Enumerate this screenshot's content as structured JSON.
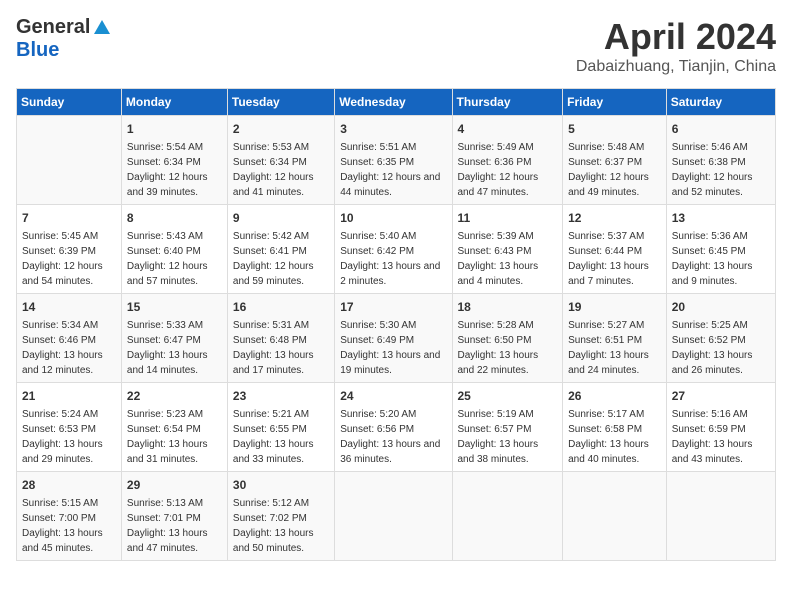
{
  "header": {
    "logo_general": "General",
    "logo_blue": "Blue",
    "title": "April 2024",
    "location": "Dabaizhuang, Tianjin, China"
  },
  "columns": [
    "Sunday",
    "Monday",
    "Tuesday",
    "Wednesday",
    "Thursday",
    "Friday",
    "Saturday"
  ],
  "weeks": [
    [
      {
        "day": "",
        "sunrise": "",
        "sunset": "",
        "daylight": ""
      },
      {
        "day": "1",
        "sunrise": "Sunrise: 5:54 AM",
        "sunset": "Sunset: 6:34 PM",
        "daylight": "Daylight: 12 hours and 39 minutes."
      },
      {
        "day": "2",
        "sunrise": "Sunrise: 5:53 AM",
        "sunset": "Sunset: 6:34 PM",
        "daylight": "Daylight: 12 hours and 41 minutes."
      },
      {
        "day": "3",
        "sunrise": "Sunrise: 5:51 AM",
        "sunset": "Sunset: 6:35 PM",
        "daylight": "Daylight: 12 hours and 44 minutes."
      },
      {
        "day": "4",
        "sunrise": "Sunrise: 5:49 AM",
        "sunset": "Sunset: 6:36 PM",
        "daylight": "Daylight: 12 hours and 47 minutes."
      },
      {
        "day": "5",
        "sunrise": "Sunrise: 5:48 AM",
        "sunset": "Sunset: 6:37 PM",
        "daylight": "Daylight: 12 hours and 49 minutes."
      },
      {
        "day": "6",
        "sunrise": "Sunrise: 5:46 AM",
        "sunset": "Sunset: 6:38 PM",
        "daylight": "Daylight: 12 hours and 52 minutes."
      }
    ],
    [
      {
        "day": "7",
        "sunrise": "Sunrise: 5:45 AM",
        "sunset": "Sunset: 6:39 PM",
        "daylight": "Daylight: 12 hours and 54 minutes."
      },
      {
        "day": "8",
        "sunrise": "Sunrise: 5:43 AM",
        "sunset": "Sunset: 6:40 PM",
        "daylight": "Daylight: 12 hours and 57 minutes."
      },
      {
        "day": "9",
        "sunrise": "Sunrise: 5:42 AM",
        "sunset": "Sunset: 6:41 PM",
        "daylight": "Daylight: 12 hours and 59 minutes."
      },
      {
        "day": "10",
        "sunrise": "Sunrise: 5:40 AM",
        "sunset": "Sunset: 6:42 PM",
        "daylight": "Daylight: 13 hours and 2 minutes."
      },
      {
        "day": "11",
        "sunrise": "Sunrise: 5:39 AM",
        "sunset": "Sunset: 6:43 PM",
        "daylight": "Daylight: 13 hours and 4 minutes."
      },
      {
        "day": "12",
        "sunrise": "Sunrise: 5:37 AM",
        "sunset": "Sunset: 6:44 PM",
        "daylight": "Daylight: 13 hours and 7 minutes."
      },
      {
        "day": "13",
        "sunrise": "Sunrise: 5:36 AM",
        "sunset": "Sunset: 6:45 PM",
        "daylight": "Daylight: 13 hours and 9 minutes."
      }
    ],
    [
      {
        "day": "14",
        "sunrise": "Sunrise: 5:34 AM",
        "sunset": "Sunset: 6:46 PM",
        "daylight": "Daylight: 13 hours and 12 minutes."
      },
      {
        "day": "15",
        "sunrise": "Sunrise: 5:33 AM",
        "sunset": "Sunset: 6:47 PM",
        "daylight": "Daylight: 13 hours and 14 minutes."
      },
      {
        "day": "16",
        "sunrise": "Sunrise: 5:31 AM",
        "sunset": "Sunset: 6:48 PM",
        "daylight": "Daylight: 13 hours and 17 minutes."
      },
      {
        "day": "17",
        "sunrise": "Sunrise: 5:30 AM",
        "sunset": "Sunset: 6:49 PM",
        "daylight": "Daylight: 13 hours and 19 minutes."
      },
      {
        "day": "18",
        "sunrise": "Sunrise: 5:28 AM",
        "sunset": "Sunset: 6:50 PM",
        "daylight": "Daylight: 13 hours and 22 minutes."
      },
      {
        "day": "19",
        "sunrise": "Sunrise: 5:27 AM",
        "sunset": "Sunset: 6:51 PM",
        "daylight": "Daylight: 13 hours and 24 minutes."
      },
      {
        "day": "20",
        "sunrise": "Sunrise: 5:25 AM",
        "sunset": "Sunset: 6:52 PM",
        "daylight": "Daylight: 13 hours and 26 minutes."
      }
    ],
    [
      {
        "day": "21",
        "sunrise": "Sunrise: 5:24 AM",
        "sunset": "Sunset: 6:53 PM",
        "daylight": "Daylight: 13 hours and 29 minutes."
      },
      {
        "day": "22",
        "sunrise": "Sunrise: 5:23 AM",
        "sunset": "Sunset: 6:54 PM",
        "daylight": "Daylight: 13 hours and 31 minutes."
      },
      {
        "day": "23",
        "sunrise": "Sunrise: 5:21 AM",
        "sunset": "Sunset: 6:55 PM",
        "daylight": "Daylight: 13 hours and 33 minutes."
      },
      {
        "day": "24",
        "sunrise": "Sunrise: 5:20 AM",
        "sunset": "Sunset: 6:56 PM",
        "daylight": "Daylight: 13 hours and 36 minutes."
      },
      {
        "day": "25",
        "sunrise": "Sunrise: 5:19 AM",
        "sunset": "Sunset: 6:57 PM",
        "daylight": "Daylight: 13 hours and 38 minutes."
      },
      {
        "day": "26",
        "sunrise": "Sunrise: 5:17 AM",
        "sunset": "Sunset: 6:58 PM",
        "daylight": "Daylight: 13 hours and 40 minutes."
      },
      {
        "day": "27",
        "sunrise": "Sunrise: 5:16 AM",
        "sunset": "Sunset: 6:59 PM",
        "daylight": "Daylight: 13 hours and 43 minutes."
      }
    ],
    [
      {
        "day": "28",
        "sunrise": "Sunrise: 5:15 AM",
        "sunset": "Sunset: 7:00 PM",
        "daylight": "Daylight: 13 hours and 45 minutes."
      },
      {
        "day": "29",
        "sunrise": "Sunrise: 5:13 AM",
        "sunset": "Sunset: 7:01 PM",
        "daylight": "Daylight: 13 hours and 47 minutes."
      },
      {
        "day": "30",
        "sunrise": "Sunrise: 5:12 AM",
        "sunset": "Sunset: 7:02 PM",
        "daylight": "Daylight: 13 hours and 50 minutes."
      },
      {
        "day": "",
        "sunrise": "",
        "sunset": "",
        "daylight": ""
      },
      {
        "day": "",
        "sunrise": "",
        "sunset": "",
        "daylight": ""
      },
      {
        "day": "",
        "sunrise": "",
        "sunset": "",
        "daylight": ""
      },
      {
        "day": "",
        "sunrise": "",
        "sunset": "",
        "daylight": ""
      }
    ]
  ]
}
